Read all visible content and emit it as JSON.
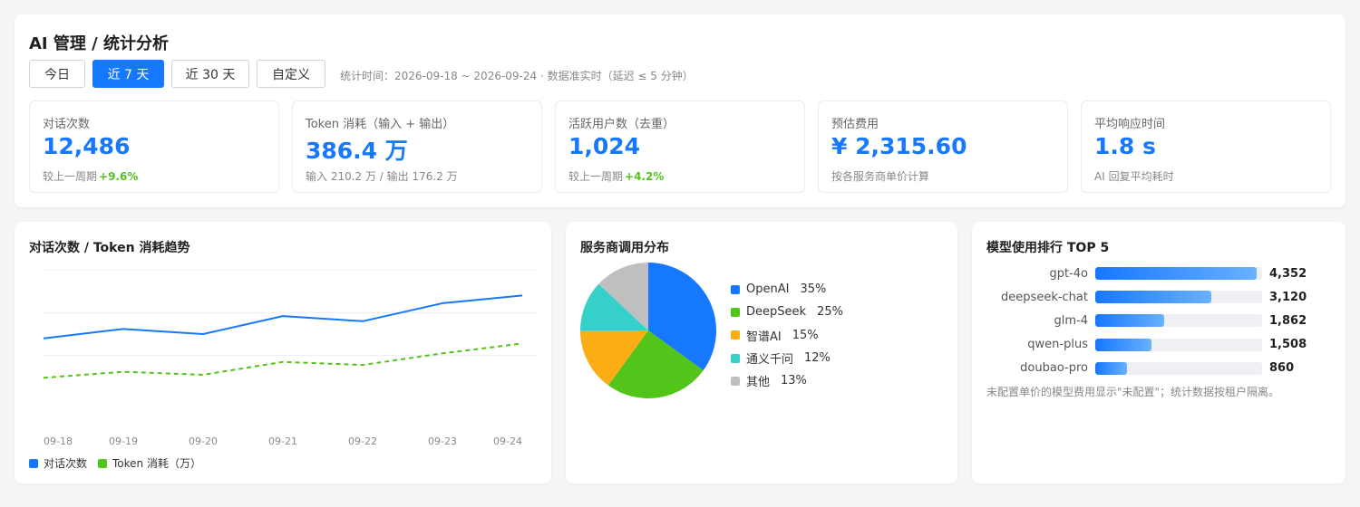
{
  "header": {
    "title": "AI 管理 / 统计分析",
    "ranges": [
      "今日",
      "近 7 天",
      "近 30 天",
      "自定义"
    ],
    "active_range": "近 7 天",
    "range_note": "统计时间：2026-09-18 ~ 2026-09-24 · 数据准实时（延迟 ≤ 5 分钟）"
  },
  "kpis": [
    {
      "label": "对话次数",
      "value": "12,486",
      "sub": "较上一周期",
      "change": "+9.6%"
    },
    {
      "label": "Token 消耗（输入 + 输出）",
      "value": "386.4 万",
      "sub": "输入 210.2 万 / 输出 176.2 万",
      "change": ""
    },
    {
      "label": "活跃用户数（去重）",
      "value": "1,024",
      "sub": "较上一周期",
      "change": "+4.2%"
    },
    {
      "label": "预估费用",
      "value": "¥ 2,315.60",
      "sub": "按各服务商单价计算",
      "change": ""
    },
    {
      "label": "平均响应时间",
      "value": "1.8 s",
      "sub": "AI 回复平均耗时",
      "change": ""
    }
  ],
  "trend": {
    "title": "对话次数 / Token 消耗趋势",
    "legend": [
      "对话次数",
      "Token 消耗（万）"
    ]
  },
  "pie": {
    "title": "服务商调用分布"
  },
  "ranking": {
    "title": "模型使用排行 TOP 5",
    "note": "未配置单价的模型费用显示\"未配置\"；统计数据按租户隔离。"
  },
  "colors": {
    "primary": "#1677ff",
    "green": "#52c41a",
    "orange": "#faad14",
    "teal": "#36cfc9",
    "gray": "#bfbfbf"
  },
  "chart_data": [
    {
      "type": "line",
      "x": [
        "09-18",
        "09-19",
        "09-20",
        "09-21",
        "09-22",
        "09-23",
        "09-24"
      ],
      "ylim": [
        0,
        3000
      ],
      "grid": true,
      "series": [
        {
          "name": "对话次数",
          "values": [
            1400,
            1620,
            1500,
            1920,
            1800,
            2220,
            2400
          ],
          "color": "#1677ff",
          "style": "solid"
        },
        {
          "name": "Token 消耗（万）",
          "values": [
            480,
            620,
            550,
            850,
            780,
            1050,
            1280
          ],
          "color": "#52c41a",
          "style": "dashed"
        }
      ]
    },
    {
      "type": "pie",
      "categories": [
        "OpenAI",
        "DeepSeek",
        "智谱AI",
        "通义千问",
        "其他"
      ],
      "values": [
        35,
        25,
        15,
        12,
        13
      ],
      "labels": [
        "35%",
        "25%",
        "15%",
        "12%",
        "13%"
      ],
      "colors": [
        "#1677ff",
        "#52c41a",
        "#faad14",
        "#36cfc9",
        "#bfbfbf"
      ],
      "legend": "right"
    },
    {
      "type": "bar",
      "orientation": "horizontal",
      "categories": [
        "gpt-4o",
        "deepseek-chat",
        "glm-4",
        "qwen-plus",
        "doubao-pro"
      ],
      "values": [
        4352,
        3120,
        1862,
        1508,
        860
      ],
      "value_labels": [
        "4,352",
        "3,120",
        "1,862",
        "1,508",
        "860"
      ],
      "xlim": [
        0,
        4500
      ]
    }
  ]
}
